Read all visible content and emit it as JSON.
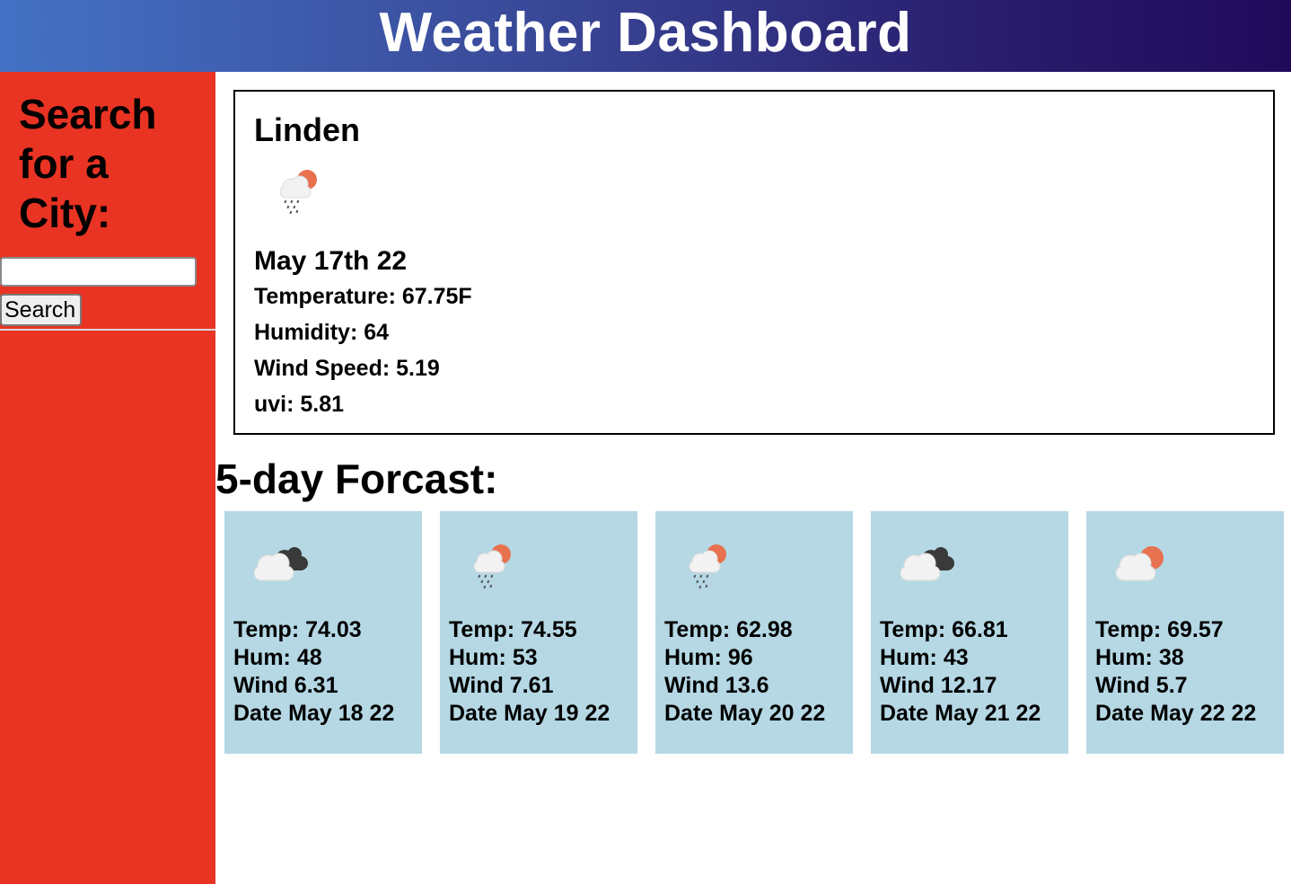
{
  "header": {
    "title": "Weather Dashboard",
    "gradient_start": "#4472c4",
    "gradient_end": "#1f0a5a"
  },
  "sidebar": {
    "heading": "Search for a City:",
    "search_placeholder": "",
    "search_value": "",
    "search_button_label": "Search",
    "background_color": "#e93323"
  },
  "current": {
    "city": "Linden",
    "icon": "rain-sun-cloud-icon",
    "date": "May 17th 22",
    "temperature": "Temperature: 67.75F",
    "humidity": "Humidity: 64",
    "wind_speed": "Wind Speed: 5.19",
    "uvi": "uvi: 5.81"
  },
  "forecast": {
    "title": "5-day Forcast:",
    "card_color": "#b5d8e4",
    "days": [
      {
        "icon": "dark-cloud-icon",
        "temp": "Temp: 74.03",
        "hum": "Hum: 48",
        "wind": "Wind 6.31",
        "date": "Date May 18 22"
      },
      {
        "icon": "rain-sun-cloud-icon",
        "temp": "Temp: 74.55",
        "hum": "Hum: 53",
        "wind": "Wind 7.61",
        "date": "Date May 19 22"
      },
      {
        "icon": "rain-sun-cloud-icon",
        "temp": "Temp: 62.98",
        "hum": "Hum: 96",
        "wind": "Wind 13.6",
        "date": "Date May 20 22"
      },
      {
        "icon": "dark-cloud-icon",
        "temp": "Temp: 66.81",
        "hum": "Hum: 43",
        "wind": "Wind 12.17",
        "date": "Date May 21 22"
      },
      {
        "icon": "sun-cloud-icon",
        "temp": "Temp: 69.57",
        "hum": "Hum: 38",
        "wind": "Wind 5.7",
        "date": "Date May 22 22"
      }
    ]
  }
}
